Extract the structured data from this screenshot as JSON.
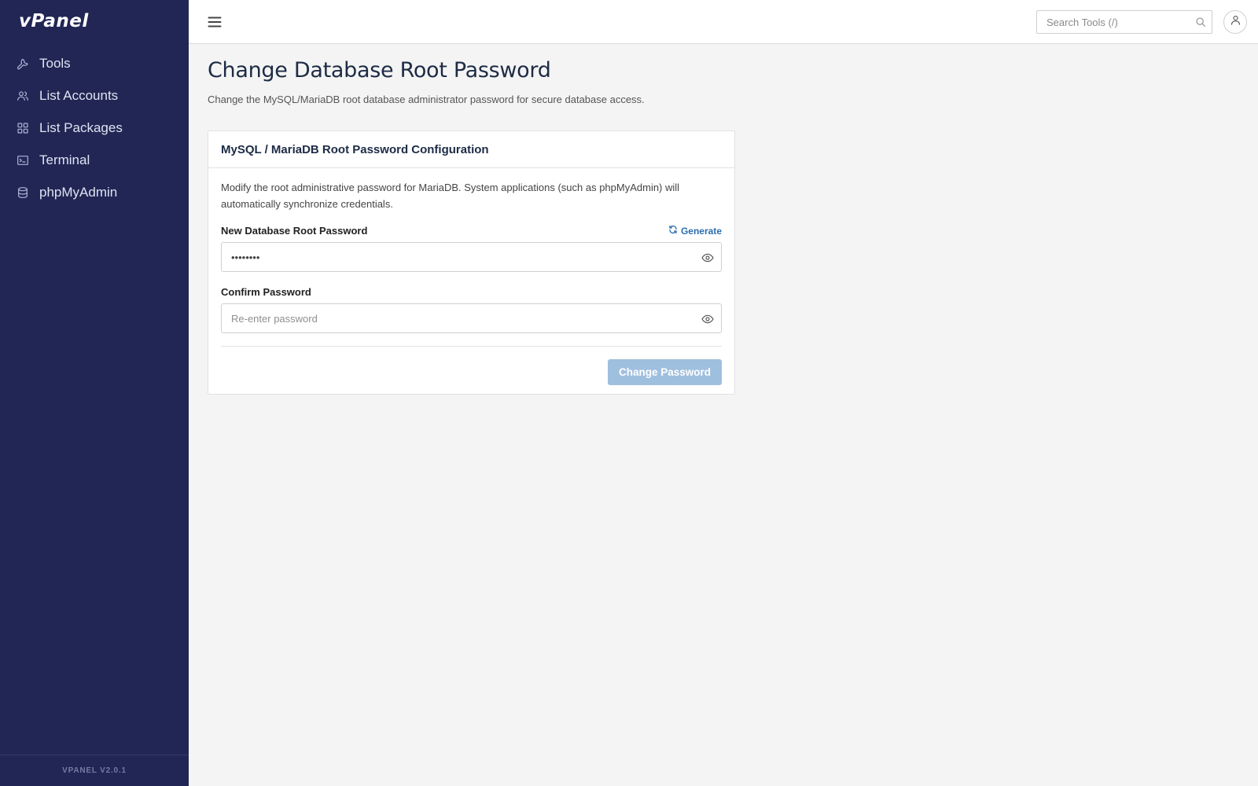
{
  "app": {
    "logo_text": "vPanel",
    "version": "VPANEL V2.0.1"
  },
  "sidebar": {
    "items": [
      {
        "label": "Tools",
        "icon": "wrench-icon"
      },
      {
        "label": "List Accounts",
        "icon": "users-icon"
      },
      {
        "label": "List Packages",
        "icon": "grid-icon"
      },
      {
        "label": "Terminal",
        "icon": "terminal-icon"
      },
      {
        "label": "phpMyAdmin",
        "icon": "database-icon"
      }
    ]
  },
  "topbar": {
    "menu_icon": "hamburger-icon",
    "search_placeholder": "Search Tools (/)",
    "search_icon": "search-icon",
    "user_icon": "user-icon"
  },
  "page": {
    "title": "Change Database Root Password",
    "subtitle": "Change the MySQL/MariaDB root database administrator password for secure database access."
  },
  "card": {
    "title": "MySQL / MariaDB Root Password Configuration",
    "description": "Modify the root administrative password for MariaDB. System applications (such as phpMyAdmin) will automatically synchronize credentials.",
    "new_password": {
      "label": "New Database Root Password",
      "value": "••••••••",
      "generate_label": "Generate",
      "generate_icon": "refresh-icon",
      "toggle_icon": "eye-icon"
    },
    "confirm_password": {
      "label": "Confirm Password",
      "value": "",
      "placeholder": "Re-enter password",
      "toggle_icon": "eye-icon"
    },
    "submit_label": "Change Password"
  },
  "colors": {
    "sidebar_bg": "#212654",
    "accent": "#2c6fb0",
    "button_disabled": "#9fbfdf",
    "page_bg": "#f4f4f4"
  }
}
